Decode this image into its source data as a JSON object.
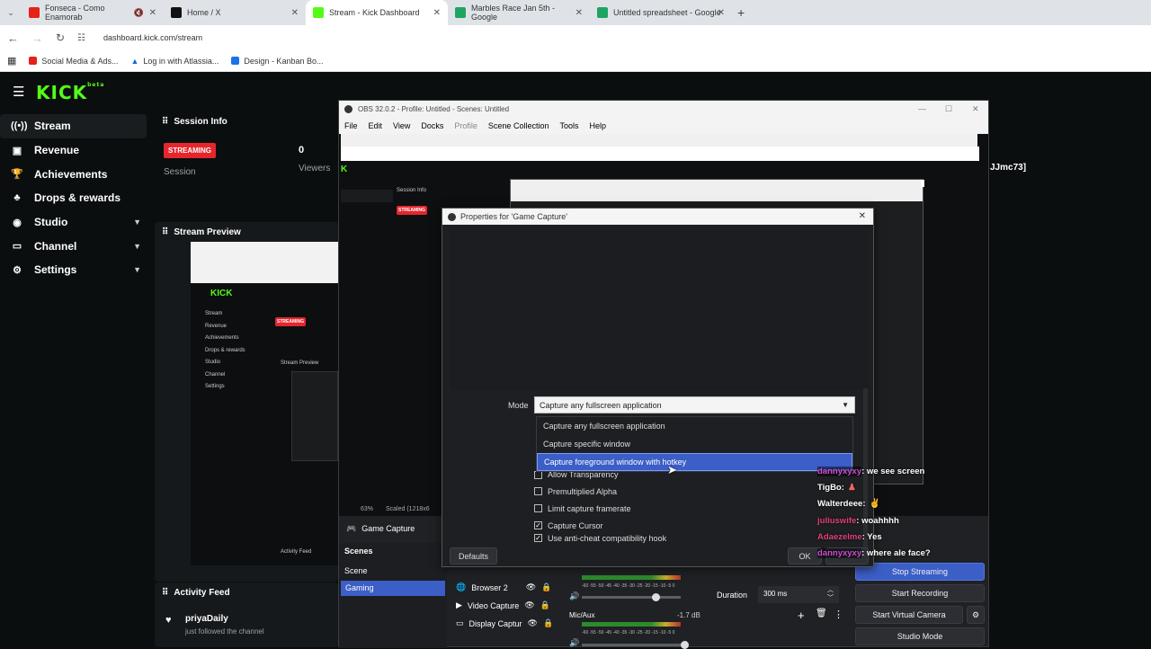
{
  "browser": {
    "tabs": [
      {
        "title": "Fonseca - Como Enamorab",
        "favicon_color": "#e62117",
        "extra": "mute-icon"
      },
      {
        "title": "Home / X",
        "favicon_color": "#111111"
      },
      {
        "title": "Stream - Kick Dashboard",
        "favicon_color": "#53fc18"
      },
      {
        "title": "Marbles Race Jan 5th - Google",
        "favicon_color": "#1fa463"
      },
      {
        "title": "Untitled spreadsheet - Google",
        "favicon_color": "#1fa463"
      }
    ],
    "url": "dashboard.kick.com/stream",
    "bookmarks": [
      {
        "label": "Social Media & Ads...",
        "color": "#e62117"
      },
      {
        "label": "Log in with Atlassia...",
        "color": "#1868db"
      },
      {
        "label": "Design - Kanban Bo...",
        "color": "#1a73e8"
      }
    ]
  },
  "kick": {
    "logo": "KICK",
    "logo_sup": "beta",
    "nav": [
      {
        "label": "Stream",
        "icon": "broadcast-icon"
      },
      {
        "label": "Revenue",
        "icon": "revenue-icon"
      },
      {
        "label": "Achievements",
        "icon": "trophy-icon"
      },
      {
        "label": "Drops & rewards",
        "icon": "gift-icon"
      },
      {
        "label": "Studio",
        "icon": "studio-icon"
      },
      {
        "label": "Channel",
        "icon": "channel-icon"
      },
      {
        "label": "Settings",
        "icon": "gear-icon"
      }
    ],
    "session_info": {
      "title": "Session Info",
      "badge": "STREAMING",
      "session_label": "Session",
      "viewers_value": "0",
      "viewers_label": "Viewers"
    },
    "stream_preview": {
      "title": "Stream Preview"
    },
    "activity_feed": {
      "title": "Activity Feed",
      "user": "priyaDaily",
      "message": "just followed the channel"
    },
    "username_partial": "JJmc73]"
  },
  "obs": {
    "title": "OBS 32.0.2 - Profile: Untitled - Scenes: Untitled",
    "menu": [
      "File",
      "Edit",
      "View",
      "Docks",
      "Profile",
      "Scene Collection",
      "Tools",
      "Help"
    ],
    "zoom": "63%",
    "scaled": "Scaled (1218x6",
    "source_label": "Game Capture",
    "scenes_title": "Scenes",
    "scenes": [
      "Scene",
      "Gaming"
    ],
    "sources": [
      "Browser 2",
      "Video Capture",
      "Display Captur"
    ],
    "mixer": {
      "mic_label": "Mic/Aux",
      "mic_db": "-1.7 dB",
      "scale": "-60 -55 -50 -45 -40 -35 -30 -25 -20 -15 -10 -5 0"
    },
    "duration_label": "Duration",
    "duration_value": "300 ms",
    "controls": [
      "Stop Streaming",
      "Start Recording",
      "Start Virtual Camera",
      "Studio Mode"
    ]
  },
  "dialog": {
    "title": "Properties for 'Game Capture'",
    "mode_label": "Mode",
    "mode_value": "Capture any fullscreen application",
    "options": [
      "Capture any fullscreen application",
      "Capture specific window",
      "Capture foreground window with hotkey"
    ],
    "checkboxes": [
      {
        "label": "Allow Transparency",
        "checked": false
      },
      {
        "label": "Premultiplied Alpha",
        "checked": false
      },
      {
        "label": "Limit capture framerate",
        "checked": false
      },
      {
        "label": "Capture Cursor",
        "checked": true
      },
      {
        "label": "Use anti-cheat compatibility hook",
        "checked": true
      }
    ],
    "defaults_label": "Defaults",
    "ok_label": "OK"
  },
  "chat": [
    {
      "user": "dannyxyxy",
      "color": "#d24cd8",
      "text": ": we see screen"
    },
    {
      "user": "TigBo",
      "color": "#ffffff",
      "text": ":"
    },
    {
      "user": "Walterdeee",
      "color": "#ffffff",
      "text": ":"
    },
    {
      "user": "juliuswife",
      "color": "#e0437b",
      "text": ": woahhhh"
    },
    {
      "user": "Adaezelme",
      "color": "#e0437b",
      "text": ": Yes"
    },
    {
      "user": "dannyxyxy",
      "color": "#d24cd8",
      "text": ": where ale face?"
    }
  ]
}
